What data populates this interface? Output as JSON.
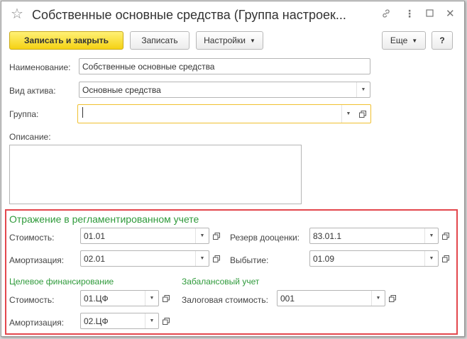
{
  "window": {
    "title": "Собственные основные средства (Группа настроек..."
  },
  "toolbar": {
    "save_close_label": "Записать и закрыть",
    "save_label": "Записать",
    "settings_label": "Настройки",
    "more_label": "Еще",
    "help_label": "?"
  },
  "form": {
    "name_label": "Наименование:",
    "name_value": "Собственные основные средства",
    "asset_type_label": "Вид актива:",
    "asset_type_value": "Основные средства",
    "group_label": "Группа:",
    "group_value": "",
    "description_label": "Описание:",
    "description_value": ""
  },
  "reg_accounting": {
    "title": "Отражение в регламентированном учете",
    "cost_label": "Стоимость:",
    "cost_value": "01.01",
    "amort_label": "Амортизация:",
    "amort_value": "02.01",
    "revaluation_label": "Резерв дооценки:",
    "revaluation_value": "83.01.1",
    "disposal_label": "Выбытие:",
    "disposal_value": "01.09"
  },
  "target_financing": {
    "title": "Целевое финансирование",
    "cost_label": "Стоимость:",
    "cost_value": "01.ЦФ",
    "amort_label": "Амортизация:",
    "amort_value": "02.ЦФ"
  },
  "off_balance": {
    "title": "Забалансовый учет",
    "pledge_label": "Залоговая стоимость:",
    "pledge_value": "001"
  },
  "colors": {
    "accent_green": "#2f9a3b",
    "highlight_red": "#e3474d",
    "primary_button": "#f5d213"
  },
  "icons": [
    "star-icon",
    "link-icon",
    "more-icon",
    "maximize-icon",
    "close-icon",
    "dropdown-arrow-icon",
    "open-icon"
  ]
}
